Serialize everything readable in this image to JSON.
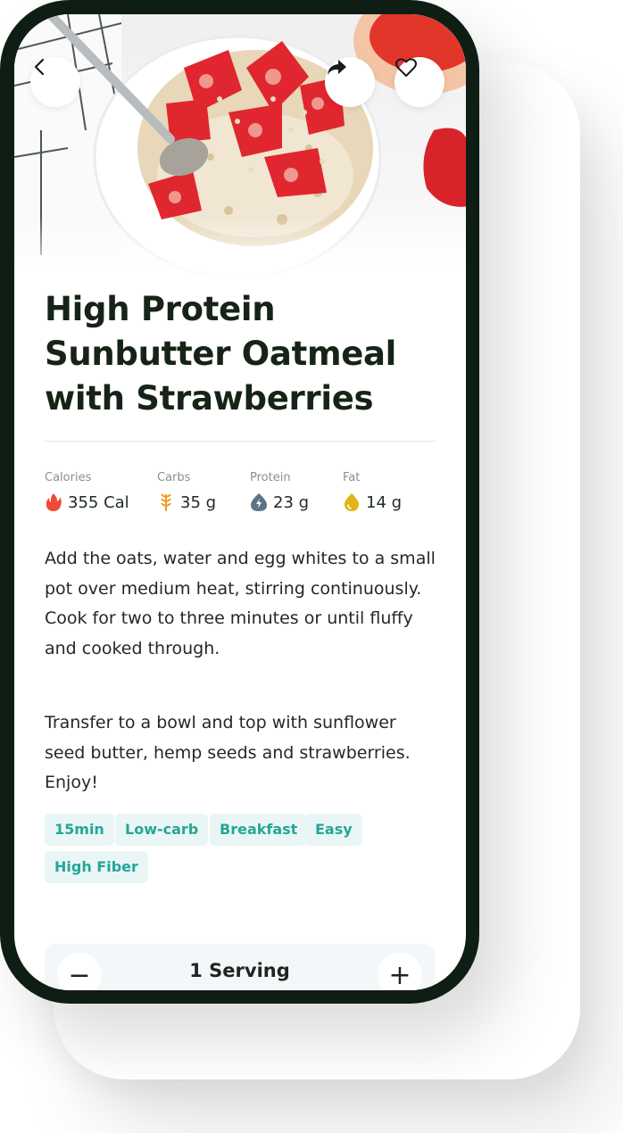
{
  "recipe": {
    "title": "High Protein Sunbutter Oatmeal with Strawberries",
    "image_alt": "Bowl of oatmeal topped with strawberries and hemp seeds"
  },
  "header": {
    "back_icon": "chevron-left-icon",
    "share_icon": "share-arrow-icon",
    "favorite_icon": "heart-outline-icon"
  },
  "nutrition": [
    {
      "label": "Calories",
      "value": "355 Cal",
      "icon": "flame-icon",
      "color": "#f04a36"
    },
    {
      "label": "Carbs",
      "value": "35 g",
      "icon": "wheat-icon",
      "color": "#f29a24"
    },
    {
      "label": "Protein",
      "value": "23 g",
      "icon": "bolt-icon",
      "color": "#5b7389"
    },
    {
      "label": "Fat",
      "value": "14 g",
      "icon": "drop-icon",
      "color": "#e2b418"
    }
  ],
  "instructions": [
    "Add the oats, water and egg whites to a small pot over medium heat, stirring continuously. Cook for two to three minutes or until fluffy and cooked through.",
    "Transfer to a bowl and top with sunflower seed butter, hemp seeds and strawberries. Enjoy!"
  ],
  "tags": [
    "15min",
    "Low-carb",
    "Breakfast",
    "Easy",
    "High Fiber"
  ],
  "serving": {
    "label": "1 Serving",
    "minus": "−",
    "plus": "+"
  },
  "colors": {
    "frame": "#0f1e14",
    "tag_bg": "#eaf6f6",
    "tag_text": "#23a797",
    "title": "#162317"
  }
}
